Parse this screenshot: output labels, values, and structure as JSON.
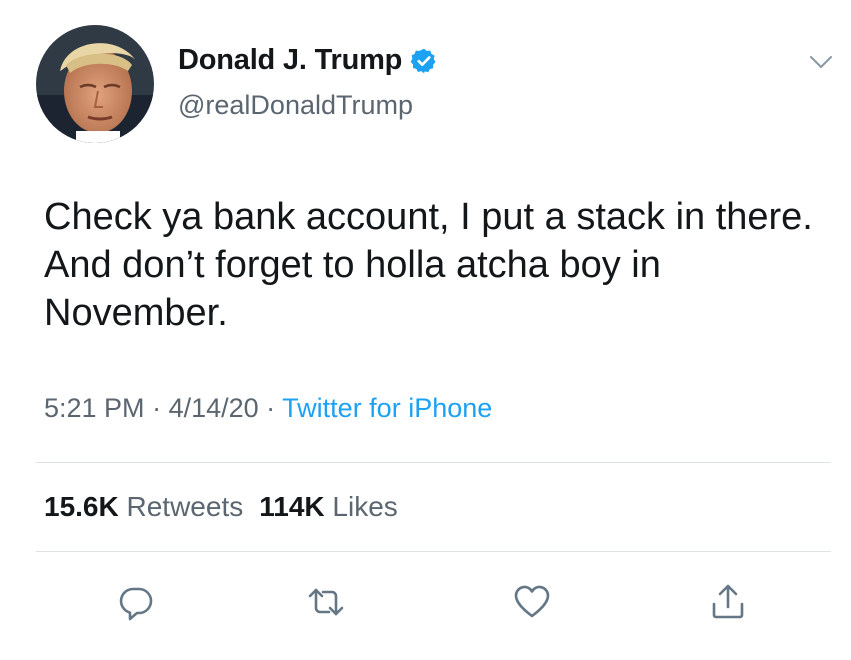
{
  "author": {
    "display_name": "Donald J. Trump",
    "handle": "@realDonaldTrump",
    "verified": true
  },
  "tweet": {
    "text": "Check ya bank account, I put a stack in there. And don’t forget to holla atcha boy in November.",
    "time": "5:21 PM",
    "date": "4/14/20",
    "separator": " · ",
    "source": "Twitter for iPhone"
  },
  "stats": {
    "retweets_count": "15.6K",
    "retweets_label": "Retweets",
    "likes_count": "114K",
    "likes_label": "Likes"
  },
  "icons": {
    "menu": "chevron-down-icon",
    "reply": "reply-icon",
    "retweet": "retweet-icon",
    "like": "heart-icon",
    "share": "share-icon",
    "verified": "verified-badge-icon"
  },
  "colors": {
    "accent": "#1da1f2",
    "secondary_text": "#5b6670",
    "primary_text": "#14171a",
    "divider": "#dde2e6"
  }
}
